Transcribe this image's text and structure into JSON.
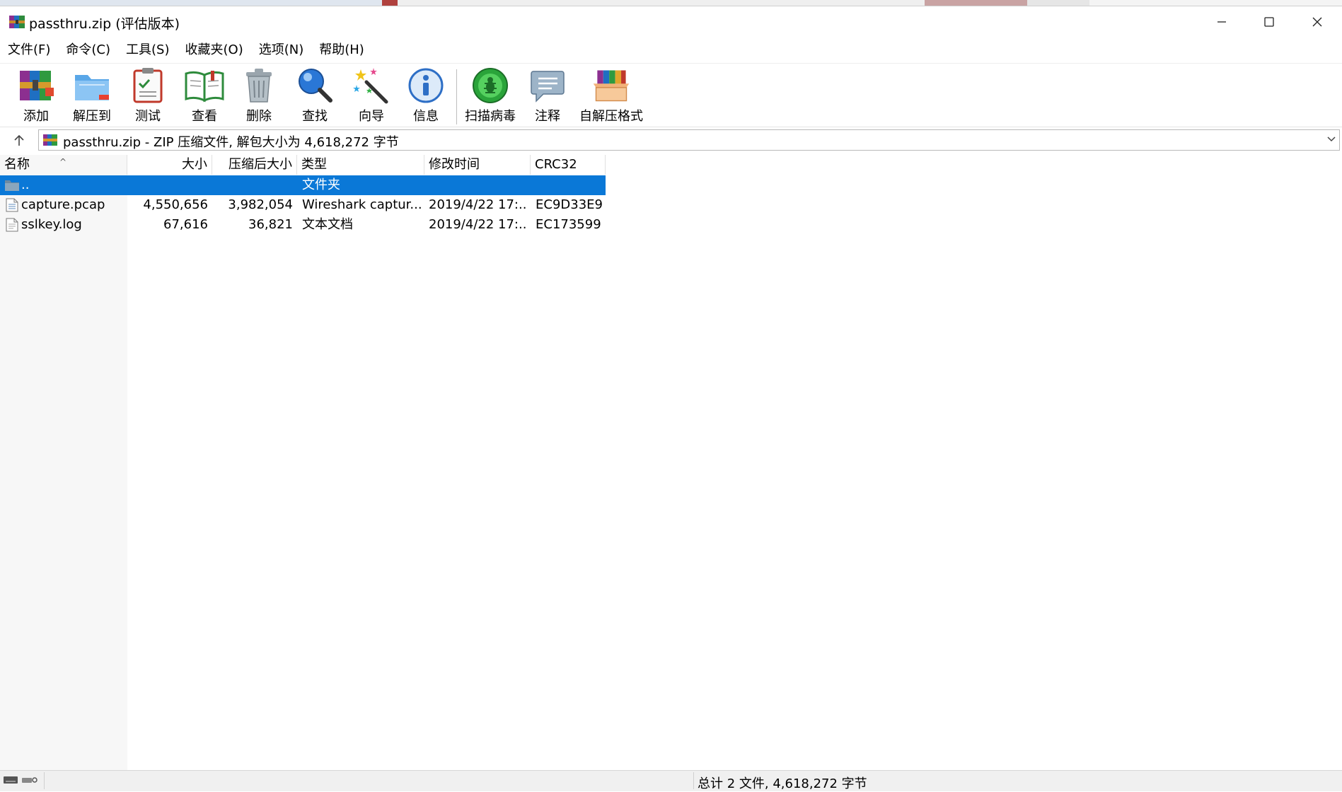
{
  "window": {
    "title": "passthru.zip (评估版本)",
    "controls": {
      "minimize": "minimize",
      "maximize": "maximize",
      "close": "close"
    }
  },
  "menu": [
    "文件(F)",
    "命令(C)",
    "工具(S)",
    "收藏夹(O)",
    "选项(N)",
    "帮助(H)"
  ],
  "toolbar": {
    "add": "添加",
    "extract": "解压到",
    "test": "测试",
    "view": "查看",
    "delete": "删除",
    "find": "查找",
    "wizard": "向导",
    "info": "信息",
    "scan": "扫描病毒",
    "comment": "注释",
    "sfx": "自解压格式"
  },
  "address": {
    "path": "passthru.zip - ZIP 压缩文件, 解包大小为 4,618,272 字节"
  },
  "columns": {
    "name": "名称",
    "size": "大小",
    "packed": "压缩后大小",
    "type": "类型",
    "modified": "修改时间",
    "crc": "CRC32"
  },
  "files": [
    {
      "name": "..",
      "size": "",
      "packed": "",
      "type": "文件夹",
      "modified": "",
      "crc": "",
      "icon": "folder-icon",
      "selected": true
    },
    {
      "name": "capture.pcap",
      "size": "4,550,656",
      "packed": "3,982,054",
      "type": "Wireshark captur...",
      "modified": "2019/4/22 17:...",
      "crc": "EC9D33E9",
      "icon": "pcap-file-icon",
      "selected": false
    },
    {
      "name": "sslkey.log",
      "size": "67,616",
      "packed": "36,821",
      "type": "文本文档",
      "modified": "2019/4/22 17:...",
      "crc": "EC173599",
      "icon": "text-file-icon",
      "selected": false
    }
  ],
  "status": {
    "summary": "总计 2 文件, 4,618,272 字节"
  },
  "colors": {
    "selection": "#0a78d7",
    "statusbar": "#f0f0f0"
  }
}
